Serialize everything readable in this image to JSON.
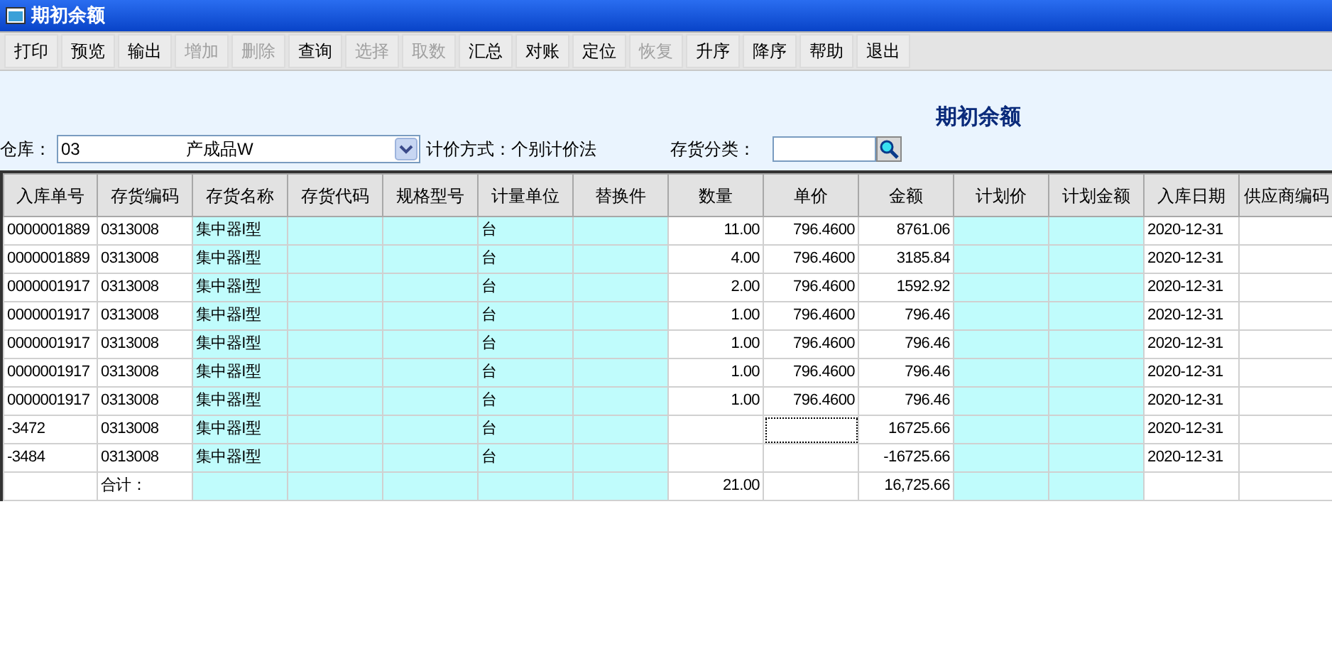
{
  "window": {
    "title": "期初余额"
  },
  "toolbar": [
    {
      "label": "打印",
      "disabled": false
    },
    {
      "label": "预览",
      "disabled": false
    },
    {
      "label": "输出",
      "disabled": false
    },
    {
      "label": "增加",
      "disabled": true
    },
    {
      "label": "删除",
      "disabled": true
    },
    {
      "label": "查询",
      "disabled": false
    },
    {
      "label": "选择",
      "disabled": true
    },
    {
      "label": "取数",
      "disabled": true
    },
    {
      "label": "汇总",
      "disabled": false
    },
    {
      "label": "对账",
      "disabled": false
    },
    {
      "label": "定位",
      "disabled": false
    },
    {
      "label": "恢复",
      "disabled": true
    },
    {
      "label": "升序",
      "disabled": false
    },
    {
      "label": "降序",
      "disabled": false
    },
    {
      "label": "帮助",
      "disabled": false
    },
    {
      "label": "退出",
      "disabled": false
    }
  ],
  "heading": "期初余额",
  "filters": {
    "warehouse_label": "仓库：",
    "warehouse_code": "03",
    "warehouse_name": "产成品W",
    "pricing": "计价方式：个别计价法",
    "category_label": "存货分类："
  },
  "table": {
    "columns": [
      {
        "label": "入库单号",
        "numeric": false,
        "tinted": false
      },
      {
        "label": "存货编码",
        "numeric": false,
        "tinted": false
      },
      {
        "label": "存货名称",
        "numeric": false,
        "tinted": true
      },
      {
        "label": "存货代码",
        "tinted": true
      },
      {
        "label": "规格型号",
        "tinted": true
      },
      {
        "label": "计量单位",
        "numeric": false,
        "tinted": true
      },
      {
        "label": "替换件",
        "tinted": true
      },
      {
        "label": "数量",
        "numeric": true,
        "tinted": false
      },
      {
        "label": "单价",
        "numeric": true,
        "tinted": false
      },
      {
        "label": "金额",
        "numeric": true,
        "tinted": false
      },
      {
        "label": "计划价",
        "tinted": true
      },
      {
        "label": "计划金额",
        "tinted": true
      },
      {
        "label": "入库日期",
        "numeric": false,
        "tinted": false
      },
      {
        "label": "供应商编码",
        "tinted": false
      }
    ],
    "rows": [
      {
        "cells": [
          "0000001889",
          "0313008",
          "集中器I型",
          null,
          null,
          "台",
          null,
          "11.00",
          "796.4600",
          "8761.06",
          null,
          null,
          "2020-12-31",
          null
        ]
      },
      {
        "cells": [
          "0000001889",
          "0313008",
          "集中器I型",
          null,
          null,
          "台",
          null,
          "4.00",
          "796.4600",
          "3185.84",
          null,
          null,
          "2020-12-31",
          null
        ]
      },
      {
        "cells": [
          "0000001917",
          "0313008",
          "集中器I型",
          null,
          null,
          "台",
          null,
          "2.00",
          "796.4600",
          "1592.92",
          null,
          null,
          "2020-12-31",
          null
        ]
      },
      {
        "cells": [
          "0000001917",
          "0313008",
          "集中器I型",
          null,
          null,
          "台",
          null,
          "1.00",
          "796.4600",
          "796.46",
          null,
          null,
          "2020-12-31",
          null
        ]
      },
      {
        "cells": [
          "0000001917",
          "0313008",
          "集中器I型",
          null,
          null,
          "台",
          null,
          "1.00",
          "796.4600",
          "796.46",
          null,
          null,
          "2020-12-31",
          null
        ]
      },
      {
        "cells": [
          "0000001917",
          "0313008",
          "集中器I型",
          null,
          null,
          "台",
          null,
          "1.00",
          "796.4600",
          "796.46",
          null,
          null,
          "2020-12-31",
          null
        ]
      },
      {
        "cells": [
          "0000001917",
          "0313008",
          "集中器I型",
          null,
          null,
          "台",
          null,
          "1.00",
          "796.4600",
          "796.46",
          null,
          null,
          "2020-12-31",
          null
        ]
      },
      {
        "cells": [
          "-3472",
          "0313008",
          "集中器I型",
          null,
          null,
          "台",
          null,
          null,
          {
            "focused": true
          },
          "16725.66",
          null,
          null,
          "2020-12-31",
          null
        ]
      },
      {
        "cells": [
          "-3484",
          "0313008",
          "集中器I型",
          null,
          null,
          "台",
          null,
          null,
          null,
          "-16725.66",
          null,
          null,
          "2020-12-31",
          null
        ]
      },
      {
        "cells": [
          null,
          "合计：",
          null,
          null,
          null,
          null,
          null,
          "21.00",
          null,
          "16,725.66",
          null,
          null,
          null,
          null
        ]
      }
    ]
  }
}
